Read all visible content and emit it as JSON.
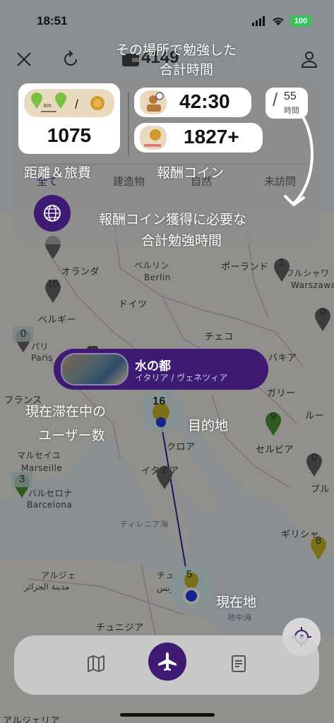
{
  "status_bar": {
    "time": "18:51",
    "battery": "100"
  },
  "header": {
    "coin_count": "4149"
  },
  "annotations": {
    "study_time_title_line1": "その場所で勉強した",
    "study_time_title_line2": "合計時間",
    "distance_cost_label": "距離＆旅費",
    "reward_coin_label": "報酬コイン",
    "required_time_line1": "報酬コイン獲得に必要な",
    "required_time_line2": "合計勉強時間",
    "current_users_line1": "現在滞在中の",
    "current_users_line2": "ユーザー数",
    "destination_label": "目的地",
    "current_location_label": "現在地"
  },
  "panel": {
    "distance_value": "1075",
    "study_time_value": "42:30",
    "reward_coin_value": "1827+",
    "required_hours": "55",
    "required_hours_unit": "時間",
    "tabs": [
      "全て",
      "建造物",
      "自然",
      "未訪問"
    ]
  },
  "destination": {
    "name": "水の都",
    "location": "イタリア / ヴェネツィア"
  },
  "map": {
    "labels": [
      {
        "key": "netherlands",
        "text": "オランダ"
      },
      {
        "key": "berlin_jp",
        "text": "ベルリン"
      },
      {
        "key": "berlin",
        "text": "Berlin"
      },
      {
        "key": "poland",
        "text": "ポーランド"
      },
      {
        "key": "warsaw_jp",
        "text": "ワルシャワ"
      },
      {
        "key": "warsaw",
        "text": "Warszawa"
      },
      {
        "key": "germany",
        "text": "ドイツ"
      },
      {
        "key": "belgium",
        "text": "ベルギー"
      },
      {
        "key": "paris_jp",
        "text": "パリ"
      },
      {
        "key": "paris",
        "text": "Paris"
      },
      {
        "key": "czech",
        "text": "チェコ"
      },
      {
        "key": "slovakia",
        "text": "バキア"
      },
      {
        "key": "france",
        "text": "フランス"
      },
      {
        "key": "hungary",
        "text": "ガリー"
      },
      {
        "key": "romania",
        "text": "ルー"
      },
      {
        "key": "croatia",
        "text": "クロア"
      },
      {
        "key": "serbia",
        "text": "セルビア"
      },
      {
        "key": "marseille_jp",
        "text": "マルセイユ"
      },
      {
        "key": "marseille",
        "text": "Marseille"
      },
      {
        "key": "barcelona_jp",
        "text": "バルセロナ"
      },
      {
        "key": "barcelona",
        "text": "Barcelona"
      },
      {
        "key": "italy",
        "text": "イタリア"
      },
      {
        "key": "bulgaria",
        "text": "ブル"
      },
      {
        "key": "tyrrhenian",
        "text": "ティレニア海"
      },
      {
        "key": "greece",
        "text": "ギリシャ"
      },
      {
        "key": "algiers_jp",
        "text": "アルジェ"
      },
      {
        "key": "algiers_ar",
        "text": "مدينة الجزائر"
      },
      {
        "key": "tunis_jp",
        "text": "チュニス"
      },
      {
        "key": "tunis_ar",
        "text": "تونس"
      },
      {
        "key": "mediterranean",
        "text": "地中海"
      },
      {
        "key": "tunisia",
        "text": "チュニジア"
      },
      {
        "key": "algeria",
        "text": "アルジェリア"
      }
    ],
    "pins": [
      {
        "key": "p_uk",
        "count": ""
      },
      {
        "key": "p_nl",
        "count": "10"
      },
      {
        "key": "p_poland",
        "count": "1"
      },
      {
        "key": "p_east",
        "count": "0"
      },
      {
        "key": "p_paris",
        "count": "0"
      },
      {
        "key": "p_de",
        "count": "12"
      },
      {
        "key": "p_venice",
        "count": "16"
      },
      {
        "key": "p_serbia",
        "count": "9"
      },
      {
        "key": "p_bulgaria",
        "count": "0"
      },
      {
        "key": "p_barcelona",
        "count": "3"
      },
      {
        "key": "p_rome",
        "count": "2"
      },
      {
        "key": "p_greece",
        "count": "8"
      },
      {
        "key": "p_current",
        "count": "5"
      }
    ]
  },
  "colors": {
    "accent_purple": "#3e1a73",
    "route_blue": "#1a1aa0",
    "location_blue": "#1530e0",
    "pin_gray": "#5c5c5c",
    "pin_yellow": "#c9b21a",
    "pin_green": "#3f8f2a"
  },
  "icons": {
    "close": "close-icon",
    "refresh": "refresh-icon",
    "wallet": "wallet-icon",
    "profile": "profile-icon",
    "globe": "globe-icon",
    "map": "map-icon",
    "plane": "plane-icon",
    "document": "document-icon",
    "locate": "crosshair-icon"
  }
}
